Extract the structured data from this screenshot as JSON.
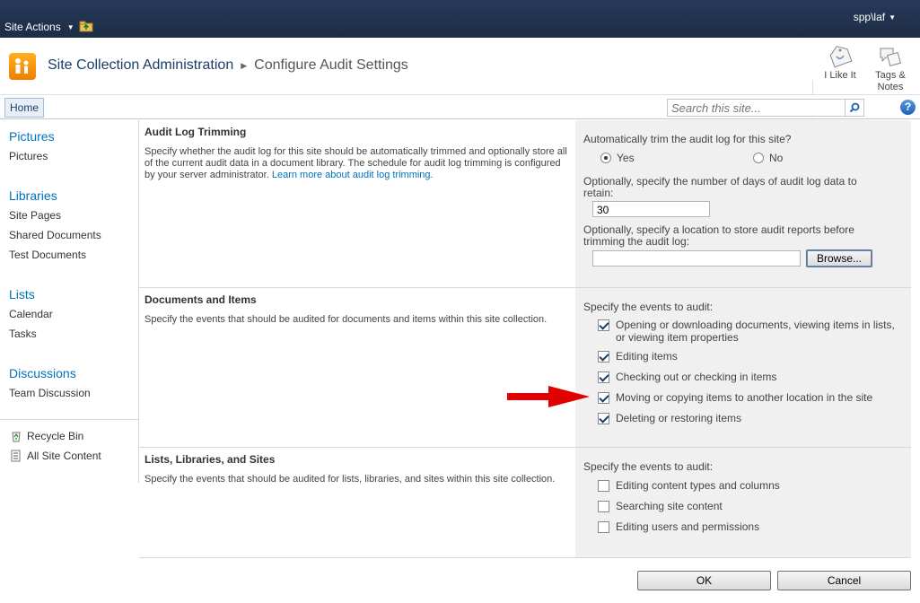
{
  "topbar": {
    "site_actions": "Site Actions",
    "user": "spp\\laf",
    "bg_color": "#1f3049"
  },
  "title": {
    "breadcrumb_site": "Site Collection Administration",
    "breadcrumb_page": "Configure Audit Settings"
  },
  "social": {
    "like_label": "I Like It",
    "tags_label_1": "Tags &",
    "tags_label_2": "Notes"
  },
  "ribbon": {
    "home_tab": "Home",
    "search_placeholder": "Search this site...",
    "help": "?"
  },
  "leftnav": {
    "pictures_heading": "Pictures",
    "pictures_item": "Pictures",
    "libraries_heading": "Libraries",
    "libraries_items": [
      "Site Pages",
      "Shared Documents",
      "Test Documents"
    ],
    "lists_heading": "Lists",
    "lists_items": [
      "Calendar",
      "Tasks"
    ],
    "discussions_heading": "Discussions",
    "discussions_item": "Team Discussion",
    "recycle_bin": "Recycle Bin",
    "all_site_content": "All Site Content",
    "heading_color": "#0072bc"
  },
  "audit_trimming": {
    "title": "Audit Log Trimming",
    "description": "Specify whether the audit log for this site should be automatically trimmed and optionally store all of the current audit data in a document library. The schedule for audit log trimming is configured by your server administrator.",
    "learn_more": "Learn more about audit log trimming.",
    "auto_trim_label": "Automatically trim the audit log for this site?",
    "yes": "Yes",
    "no": "No",
    "selected": "Yes",
    "days_label_1": "Optionally, specify the number of days of audit log data to",
    "days_label_2": "retain:",
    "days_value": "30",
    "location_label_1": "Optionally, specify a location to store audit reports before",
    "location_label_2": "trimming the audit log:",
    "location_value": "",
    "browse": "Browse..."
  },
  "documents_items": {
    "title": "Documents and Items",
    "description": "Specify the events that should be audited for documents and items within this site collection.",
    "events_label": "Specify the events to audit:",
    "events": [
      {
        "label": "Opening or downloading documents, viewing items in lists, or viewing item properties",
        "checked": true
      },
      {
        "label": "Editing items",
        "checked": true
      },
      {
        "label": "Checking out or checking in items",
        "checked": true
      },
      {
        "label": "Moving or copying items to another location in the site",
        "checked": true
      },
      {
        "label": "Deleting or restoring items",
        "checked": true
      }
    ]
  },
  "lists_libraries_sites": {
    "title": "Lists, Libraries, and Sites",
    "description": "Specify the events that should be audited for lists, libraries, and sites within this site collection.",
    "events_label": "Specify the events to audit:",
    "events": [
      {
        "label": "Editing content types and columns",
        "checked": false
      },
      {
        "label": "Searching site content",
        "checked": false
      },
      {
        "label": "Editing users and permissions",
        "checked": false
      }
    ]
  },
  "annotation": {
    "arrow_color": "#e00000"
  },
  "buttons": {
    "ok": "OK",
    "cancel": "Cancel"
  }
}
